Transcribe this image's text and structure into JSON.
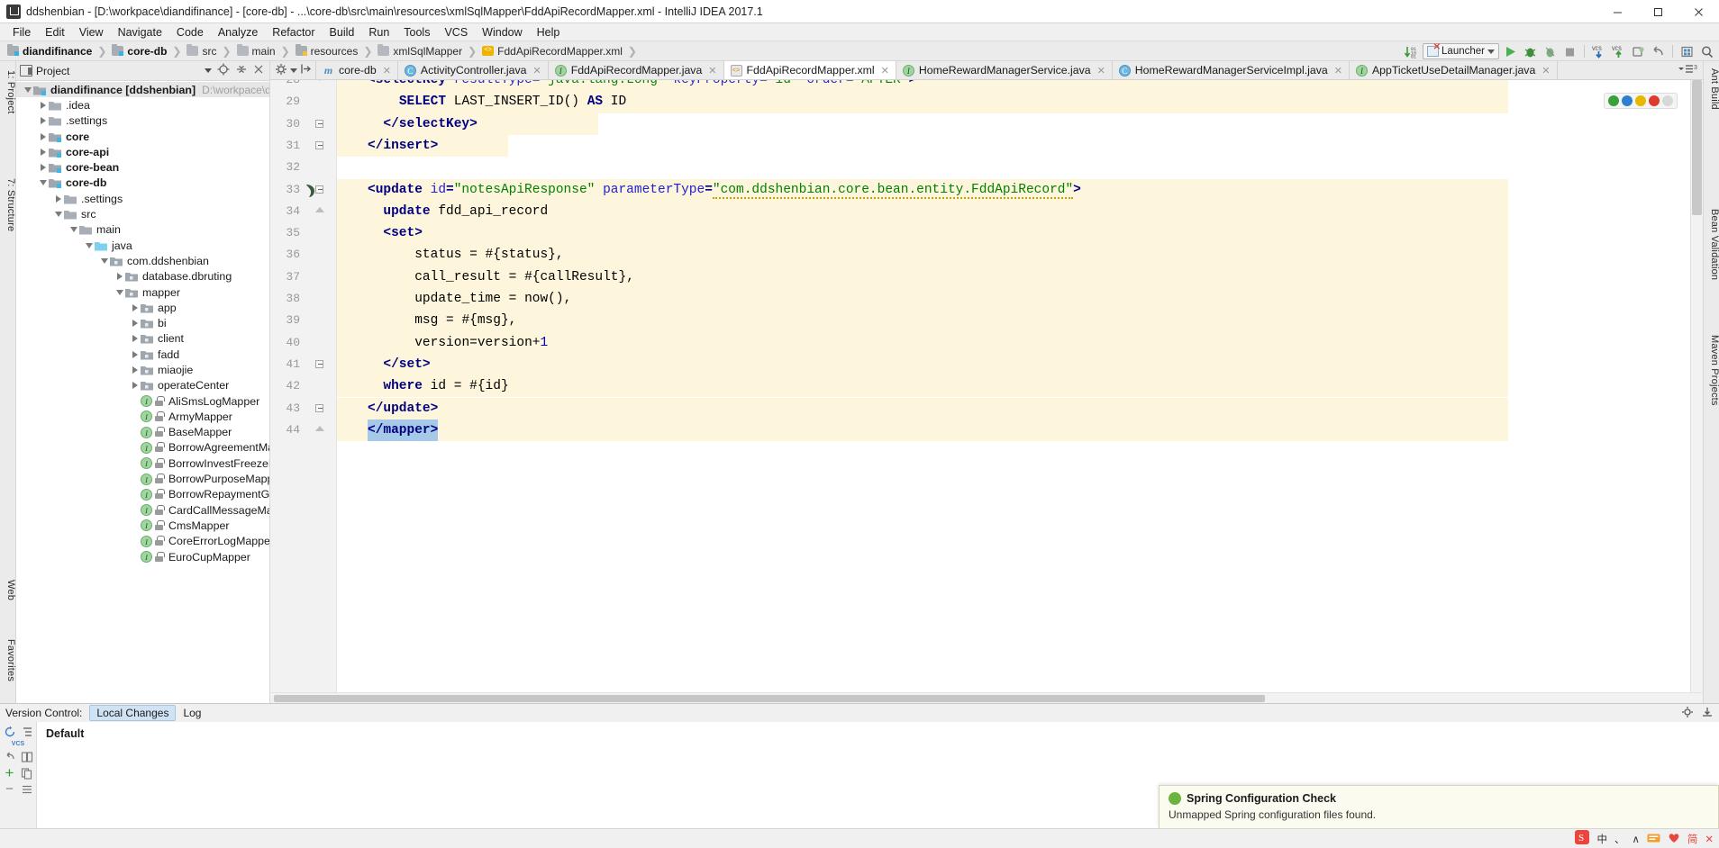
{
  "window": {
    "title": "ddshenbian - [D:\\workpace\\diandifinance] - [core-db] - ...\\core-db\\src\\main\\resources\\xmlSqlMapper\\FddApiRecordMapper.xml - IntelliJ IDEA 2017.1",
    "minimize": "–",
    "maximize": "□",
    "close": "✕"
  },
  "menu": [
    "File",
    "Edit",
    "View",
    "Navigate",
    "Code",
    "Analyze",
    "Refactor",
    "Build",
    "Run",
    "Tools",
    "VCS",
    "Window",
    "Help"
  ],
  "breadcrumb": [
    {
      "label": "diandifinance",
      "icon": "module-folder-icon",
      "bold": true
    },
    {
      "label": "core-db",
      "icon": "module-folder-icon",
      "bold": true
    },
    {
      "label": "src",
      "icon": "folder-icon",
      "bold": false
    },
    {
      "label": "main",
      "icon": "folder-icon",
      "bold": false
    },
    {
      "label": "resources",
      "icon": "resources-folder-icon",
      "bold": false
    },
    {
      "label": "xmlSqlMapper",
      "icon": "folder-icon",
      "bold": false
    },
    {
      "label": "FddApiRecordMapper.xml",
      "icon": "xml-file-icon",
      "bold": false
    }
  ],
  "toolbar": {
    "run_config": "Launcher",
    "icons": [
      "sort-icon",
      "run-icon",
      "debug-icon",
      "coverage-icon",
      "stop-icon",
      "vcs-update-icon",
      "vcs-commit-icon",
      "push-icon",
      "undo-icon",
      "open-icon",
      "search-icon"
    ]
  },
  "project_panel": {
    "title": "Project",
    "tree": [
      {
        "depth": 0,
        "arrow": "down",
        "icon": "module-folder-icon",
        "label": "diandifinance [ddshenbian]",
        "bold": true,
        "path": "D:\\workpace\\diandifi",
        "selected": true
      },
      {
        "depth": 1,
        "arrow": "right",
        "icon": "folder-icon",
        "label": ".idea",
        "bold": false
      },
      {
        "depth": 1,
        "arrow": "right",
        "icon": "folder-icon",
        "label": ".settings",
        "bold": false
      },
      {
        "depth": 1,
        "arrow": "right",
        "icon": "module-folder-icon",
        "label": "core",
        "bold": true
      },
      {
        "depth": 1,
        "arrow": "right",
        "icon": "module-folder-icon",
        "label": "core-api",
        "bold": true
      },
      {
        "depth": 1,
        "arrow": "right",
        "icon": "module-folder-icon",
        "label": "core-bean",
        "bold": true
      },
      {
        "depth": 1,
        "arrow": "down",
        "icon": "module-folder-icon",
        "label": "core-db",
        "bold": true
      },
      {
        "depth": 2,
        "arrow": "right",
        "icon": "folder-icon",
        "label": ".settings",
        "bold": false
      },
      {
        "depth": 2,
        "arrow": "down",
        "icon": "folder-icon",
        "label": "src",
        "bold": false
      },
      {
        "depth": 3,
        "arrow": "down",
        "icon": "folder-icon",
        "label": "main",
        "bold": false
      },
      {
        "depth": 4,
        "arrow": "down",
        "icon": "source-folder-icon",
        "label": "java",
        "bold": false
      },
      {
        "depth": 5,
        "arrow": "down",
        "icon": "package-icon",
        "label": "com.ddshenbian",
        "bold": false
      },
      {
        "depth": 6,
        "arrow": "right",
        "icon": "package-icon",
        "label": "database.dbruting",
        "bold": false
      },
      {
        "depth": 6,
        "arrow": "down",
        "icon": "package-icon",
        "label": "mapper",
        "bold": false
      },
      {
        "depth": 7,
        "arrow": "right",
        "icon": "package-icon",
        "label": "app",
        "bold": false
      },
      {
        "depth": 7,
        "arrow": "right",
        "icon": "package-icon",
        "label": "bi",
        "bold": false
      },
      {
        "depth": 7,
        "arrow": "right",
        "icon": "package-icon",
        "label": "client",
        "bold": false
      },
      {
        "depth": 7,
        "arrow": "right",
        "icon": "package-icon",
        "label": "fadd",
        "bold": false
      },
      {
        "depth": 7,
        "arrow": "right",
        "icon": "package-icon",
        "label": "miaojie",
        "bold": false
      },
      {
        "depth": 7,
        "arrow": "right",
        "icon": "package-icon",
        "label": "operateCenter",
        "bold": false
      },
      {
        "depth": 7,
        "arrow": "none",
        "icon": "interface-icon",
        "label": "AliSmsLogMapper",
        "bold": false
      },
      {
        "depth": 7,
        "arrow": "none",
        "icon": "interface-icon",
        "label": "ArmyMapper",
        "bold": false
      },
      {
        "depth": 7,
        "arrow": "none",
        "icon": "interface-icon",
        "label": "BaseMapper",
        "bold": false
      },
      {
        "depth": 7,
        "arrow": "none",
        "icon": "interface-icon",
        "label": "BorrowAgreementMapp",
        "bold": false
      },
      {
        "depth": 7,
        "arrow": "none",
        "icon": "interface-icon",
        "label": "BorrowInvestFreezeMap",
        "bold": false
      },
      {
        "depth": 7,
        "arrow": "none",
        "icon": "interface-icon",
        "label": "BorrowPurposeMapper",
        "bold": false
      },
      {
        "depth": 7,
        "arrow": "none",
        "icon": "interface-icon",
        "label": "BorrowRepaymentGasP",
        "bold": false
      },
      {
        "depth": 7,
        "arrow": "none",
        "icon": "interface-icon",
        "label": "CardCallMessageMapp",
        "bold": false
      },
      {
        "depth": 7,
        "arrow": "none",
        "icon": "interface-icon",
        "label": "CmsMapper",
        "bold": false
      },
      {
        "depth": 7,
        "arrow": "none",
        "icon": "interface-icon",
        "label": "CoreErrorLogMapper",
        "bold": false
      },
      {
        "depth": 7,
        "arrow": "none",
        "icon": "interface-icon",
        "label": "EuroCupMapper",
        "bold": false
      }
    ]
  },
  "editor_tabs": [
    {
      "label": "core-db",
      "icon": "maven-icon",
      "active": false
    },
    {
      "label": "ActivityController.java",
      "icon": "class-icon",
      "active": false
    },
    {
      "label": "FddApiRecordMapper.java",
      "icon": "interface-icon",
      "active": false
    },
    {
      "label": "FddApiRecordMapper.xml",
      "icon": "xml-file-icon",
      "active": true
    },
    {
      "label": "HomeRewardManagerService.java",
      "icon": "interface-icon",
      "active": false
    },
    {
      "label": "HomeRewardManagerServiceImpl.java",
      "icon": "class-icon",
      "active": false
    },
    {
      "label": "AppTicketUseDetailManager.java",
      "icon": "interface-icon",
      "active": false
    }
  ],
  "editor": {
    "lines": [
      {
        "num": 28,
        "text": "<selectKey resultType=\"java.lang.Long\" keyProperty=\"id\" order=\"AFTER\">",
        "highlight": true,
        "partial": true
      },
      {
        "num": 29,
        "text": "    SELECT LAST_INSERT_ID() AS ID",
        "highlight": true
      },
      {
        "num": 30,
        "text": "  </selectKey>",
        "highlight": true
      },
      {
        "num": 31,
        "text": "</insert>",
        "highlight": true
      },
      {
        "num": 32,
        "text": "",
        "highlight": false
      },
      {
        "num": 33,
        "text": "<update id=\"notesApiResponse\" parameterType=\"com.ddshenbian.core.bean.entity.FddApiRecord\">",
        "highlight": true
      },
      {
        "num": 34,
        "text": "  update fdd_api_record",
        "highlight": true
      },
      {
        "num": 35,
        "text": "  <set>",
        "highlight": true
      },
      {
        "num": 36,
        "text": "      status = #{status},",
        "highlight": true
      },
      {
        "num": 37,
        "text": "      call_result = #{callResult},",
        "highlight": true
      },
      {
        "num": 38,
        "text": "      update_time = now(),",
        "highlight": true
      },
      {
        "num": 39,
        "text": "      msg = #{msg},",
        "highlight": true
      },
      {
        "num": 40,
        "text": "      version=version+1",
        "highlight": true
      },
      {
        "num": 41,
        "text": "  </set>",
        "highlight": true
      },
      {
        "num": 42,
        "text": "  where id = #{id}",
        "highlight": true
      },
      {
        "num": 43,
        "text": "</update>",
        "highlight": true
      },
      {
        "num": 44,
        "text": "</mapper>",
        "highlight": true,
        "selected": true
      }
    ]
  },
  "version_control": {
    "label": "Version Control:",
    "tabs": [
      "Local Changes",
      "Log"
    ],
    "active_tab": "Local Changes",
    "changelist": "Default"
  },
  "left_strips": [
    {
      "label": "1: Project",
      "name": "tool-window-project"
    },
    {
      "label": "7: Structure",
      "name": "tool-window-structure"
    },
    {
      "label": "Web",
      "name": "tool-window-web"
    },
    {
      "label": "Favorites",
      "name": "tool-window-favorites"
    }
  ],
  "right_strips": [
    {
      "label": "Ant Build",
      "name": "tool-window-ant-build"
    },
    {
      "label": "Bean Validation",
      "name": "tool-window-bean-validation"
    },
    {
      "label": "Maven Projects",
      "name": "tool-window-maven-projects"
    }
  ],
  "notification": {
    "title": "Spring Configuration Check",
    "body": "Unmapped Spring configuration files found."
  },
  "status_bar": {
    "tray": [
      "中",
      "、",
      "∧",
      "⌨",
      "♥",
      "简",
      "✕"
    ]
  },
  "colors": {
    "accent": "#4a90c4",
    "highlight_band": "#fdf6dd",
    "selection": "#a6c9e8",
    "tag": "#000080",
    "attr": "#2020d0",
    "value": "#008000",
    "green_run": "#4caf50"
  }
}
